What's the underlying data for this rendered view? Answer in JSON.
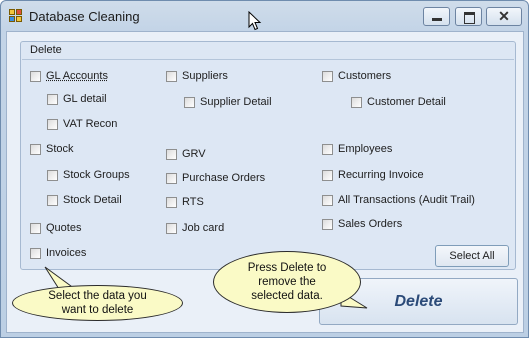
{
  "window": {
    "title": "Database Cleaning",
    "close_glyph": "✕"
  },
  "group": {
    "title": "Delete"
  },
  "checkboxes": {
    "gl_accounts": "GL Accounts",
    "gl_detail": "GL detail",
    "vat_recon": "VAT Recon",
    "stock": "Stock",
    "stock_groups": "Stock Groups",
    "stock_detail": "Stock Detail",
    "quotes": "Quotes",
    "invoices": "Invoices",
    "suppliers": "Suppliers",
    "supplier_detail": "Supplier Detail",
    "grv": "GRV",
    "purchase_orders": "Purchase Orders",
    "rts": "RTS",
    "job_card": "Job card",
    "customers": "Customers",
    "customer_detail": "Customer Detail",
    "employees": "Employees",
    "recurring_invoice": "Recurring Invoice",
    "all_transactions": "All Transactions (Audit Trail)",
    "sales_orders": "Sales Orders"
  },
  "buttons": {
    "select_all": "Select All",
    "delete": "Delete"
  },
  "callouts": {
    "left_line1": "Select the data you",
    "left_line2": "want to delete",
    "right_line1": "Press Delete to",
    "right_line2": "remove the",
    "right_line3": "selected data."
  },
  "icons": {
    "app": "app-icon",
    "cursor": "mouse-cursor-icon"
  }
}
